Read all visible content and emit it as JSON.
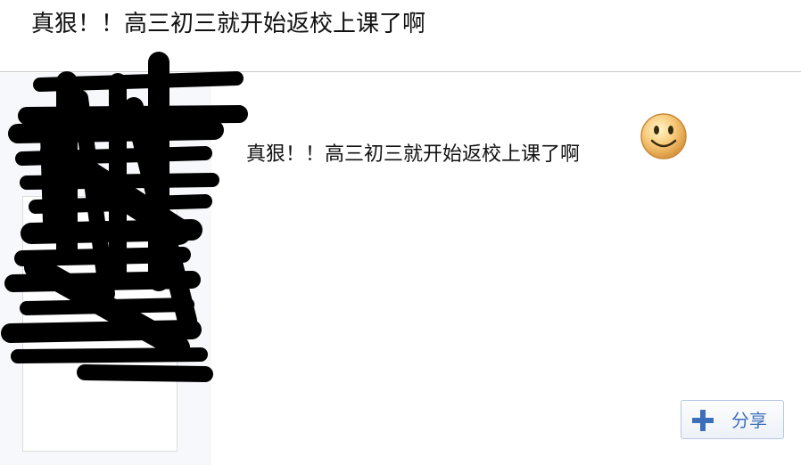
{
  "thread": {
    "title": "真狠！！高三初三就开始返校上课了啊"
  },
  "post": {
    "text": "真狠！！高三初三就开始返校上课了啊",
    "emoticon": "smiley-face-icon"
  },
  "actions": {
    "share_label": "分享",
    "share_icon": "plus-icon"
  },
  "colors": {
    "share_accent": "#3c6fb9",
    "author_panel_bg": "#f7f8fb"
  }
}
